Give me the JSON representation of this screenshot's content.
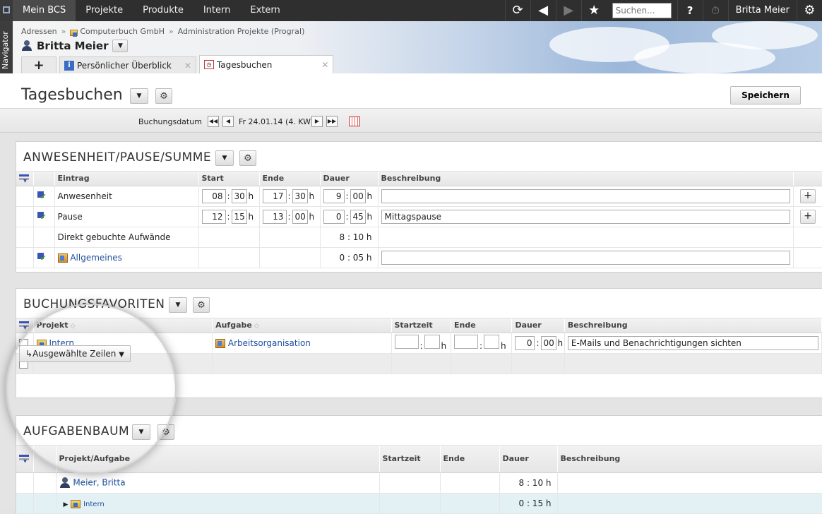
{
  "topbar": {
    "nav": [
      "Mein BCS",
      "Projekte",
      "Produkte",
      "Intern",
      "Extern"
    ],
    "active_nav": 0,
    "search_placeholder": "Suchen...",
    "help_label": "?",
    "user_name": "Britta Meier"
  },
  "navigator_label": "Navigator",
  "header": {
    "breadcrumb": [
      "Adressen",
      "Computerbuch GmbH",
      "Administration Projekte (ProgrаI)"
    ],
    "title": "Britta Meier",
    "tabs": [
      {
        "label": "+"
      },
      {
        "label": "Persönlicher Überblick"
      },
      {
        "label": "Tagesbuchen"
      }
    ]
  },
  "page": {
    "title": "Tagesbuchen",
    "save_label": "Speichern",
    "date_label": "Buchungsdatum",
    "date_value": "Fr 24.01.14 (4. KW)"
  },
  "panel_attendance": {
    "title": "ANWESENHEIT/PAUSE/SUMME",
    "columns": [
      "Eintrag",
      "Start",
      "Ende",
      "Dauer",
      "Beschreibung"
    ],
    "rows": [
      {
        "entry": "Anwesenheit",
        "start_h": "08",
        "start_m": "30",
        "end_h": "17",
        "end_m": "30",
        "dur_h": "9",
        "dur_m": "00",
        "desc": ""
      },
      {
        "entry": "Pause",
        "start_h": "12",
        "start_m": "15",
        "end_h": "13",
        "end_m": "00",
        "dur_h": "0",
        "dur_m": "45",
        "desc": "Mittagspause"
      }
    ],
    "direct": {
      "entry": "Direkt gebuchte Aufwände",
      "duration": "8 : 10 h"
    },
    "general": {
      "entry": "Allgemeines",
      "duration": "0 : 05 h"
    },
    "unit": "h",
    "plus": "+"
  },
  "panel_favorites": {
    "title": "BUCHUNGSFAVORITEN",
    "columns": [
      "Projekt",
      "Aufgabe",
      "Startzeit",
      "Ende",
      "Dauer",
      "Beschreibung"
    ],
    "row": {
      "project": "Intern",
      "task": "Arbeitsorganisation",
      "dur_h": "0",
      "dur_m": "00",
      "desc": "E-Mails und Benachrichtigungen sichten"
    },
    "unit": "h",
    "action_label": "Ausgewählte Zeilen"
  },
  "panel_tree": {
    "title": "AUFGABENBAUM",
    "columns": [
      "Projekt/Aufgabe",
      "Startzeit",
      "Ende",
      "Dauer",
      "Beschreibung"
    ],
    "rows": [
      {
        "name": "Meier, Britta",
        "duration": "8 : 10 h"
      },
      {
        "name": "Intern",
        "duration": "0 : 15 h"
      }
    ]
  },
  "colors": {
    "topbar": "#2f2f2f",
    "link": "#1f4f9e",
    "accent": "#3a54b5"
  }
}
